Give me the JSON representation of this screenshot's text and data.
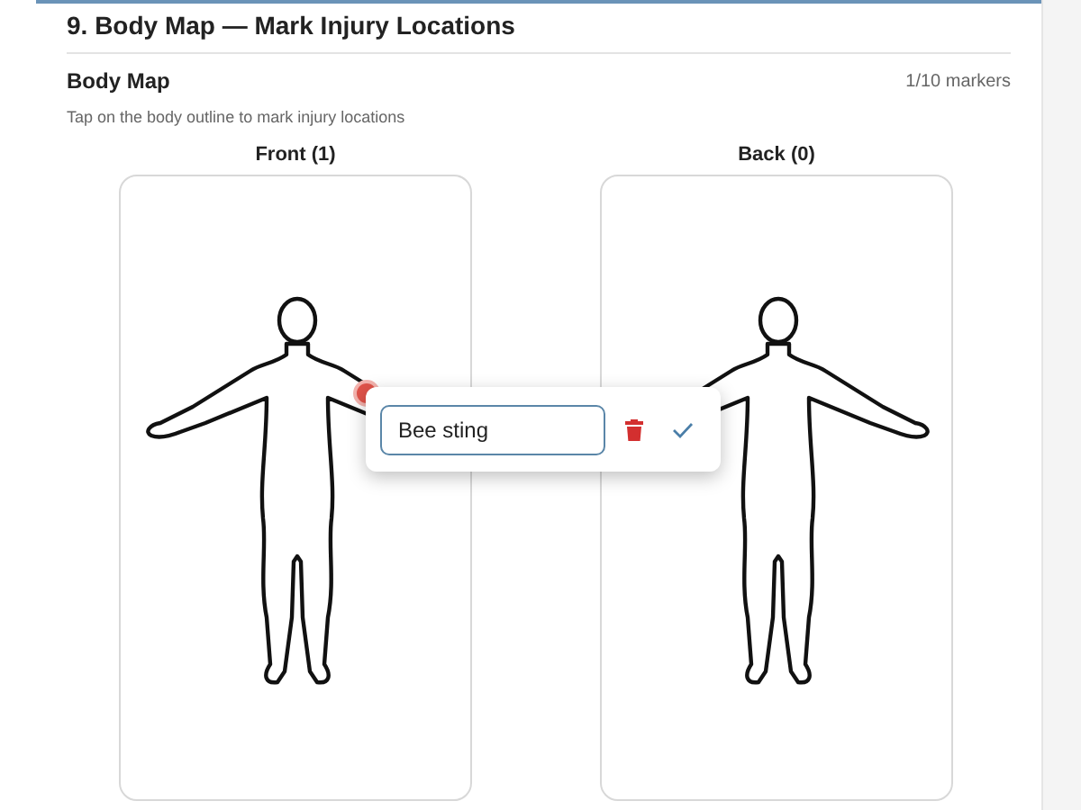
{
  "section_title": "9. Body Map — Mark Injury Locations",
  "body_map": {
    "label": "Body Map",
    "count": "1/10 markers",
    "hint": "Tap on the body outline to mark injury locations"
  },
  "views": [
    {
      "label": "Front (1)",
      "markers": [
        {
          "selected": true
        }
      ]
    },
    {
      "label": "Back (0)"
    }
  ],
  "editor": {
    "value": "Bee sting"
  }
}
